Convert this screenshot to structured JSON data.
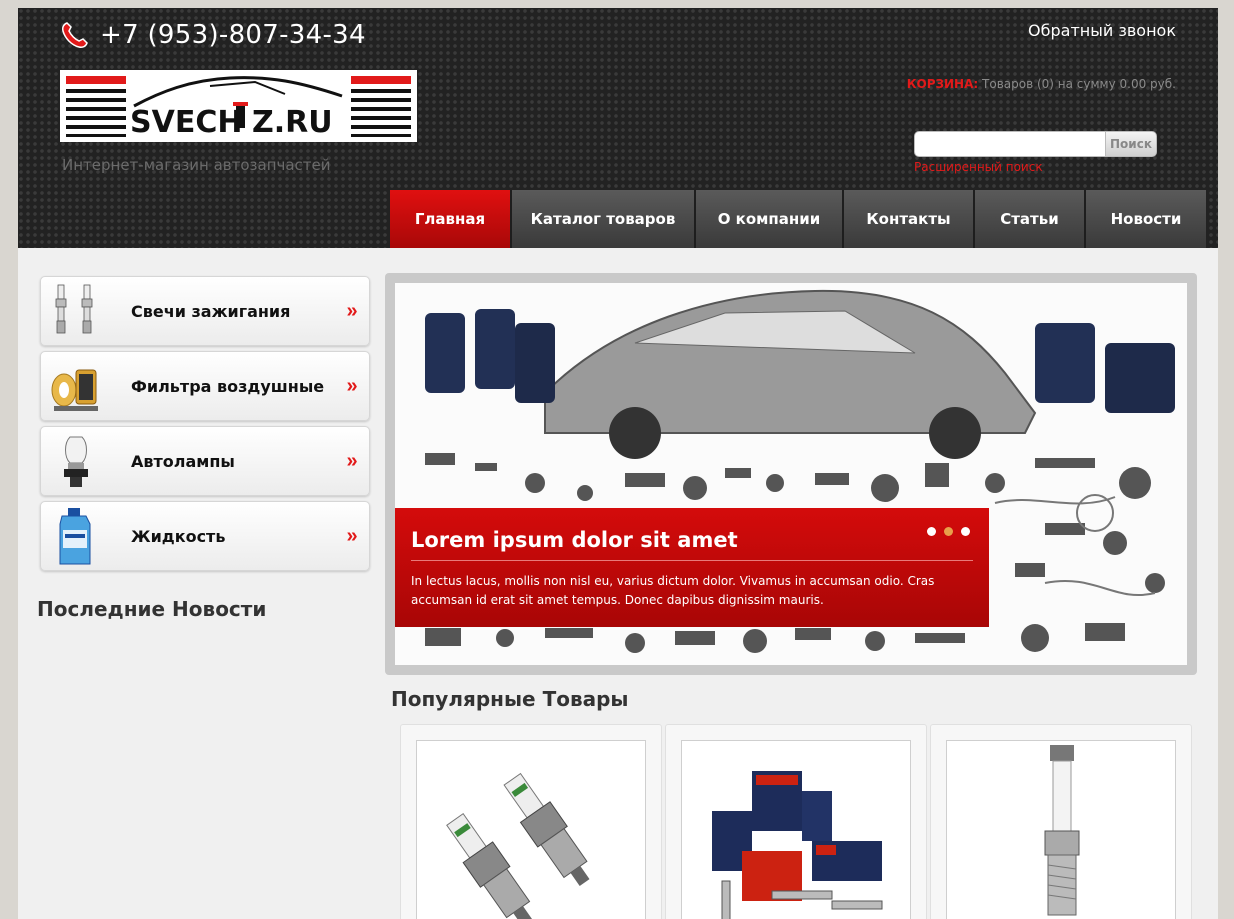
{
  "header": {
    "phone": "+7 (953)-807-34-34",
    "callback_label": "Обратный звонок",
    "tagline": "Интернет-магазин автозапчастей",
    "logo_text": "SVECHAZ.RU",
    "cart": {
      "label": "КОРЗИНА:",
      "summary": "Товаров (0) на сумму 0.00 руб."
    },
    "search": {
      "placeholder": "",
      "button_label": "Поиск",
      "advanced_label": "Расширенный поиск"
    },
    "nav": [
      {
        "label": "Главная",
        "active": true
      },
      {
        "label": "Каталог товаров",
        "active": false
      },
      {
        "label": "О компании",
        "active": false
      },
      {
        "label": "Контакты",
        "active": false
      },
      {
        "label": "Статьи",
        "active": false
      },
      {
        "label": "Новости",
        "active": false
      }
    ]
  },
  "sidebar": {
    "categories": [
      {
        "label": "Свечи зажигания",
        "icon": "spark-plug-icon"
      },
      {
        "label": "Фильтра воздушные",
        "icon": "air-filter-icon"
      },
      {
        "label": "Автолампы",
        "icon": "car-lamp-icon"
      },
      {
        "label": "Жидкость",
        "icon": "fluid-bottle-icon"
      }
    ],
    "arrow": "»",
    "news_title": "Последние Новости"
  },
  "slider": {
    "title": "Lorem ipsum dolor sit amet",
    "text": "In lectus lacus, mollis non nisl eu, varius dictum dolor. Vivamus in accumsan odio. Cras accumsan id erat sit amet tempus. Donec dapibus dignissim mauris.",
    "dots": 3,
    "active_dot": 2
  },
  "popular": {
    "title": "Популярные Товары"
  },
  "colors": {
    "accent": "#e21a1a",
    "nav_active": "#d40b0b",
    "header_bg": "#222222"
  }
}
